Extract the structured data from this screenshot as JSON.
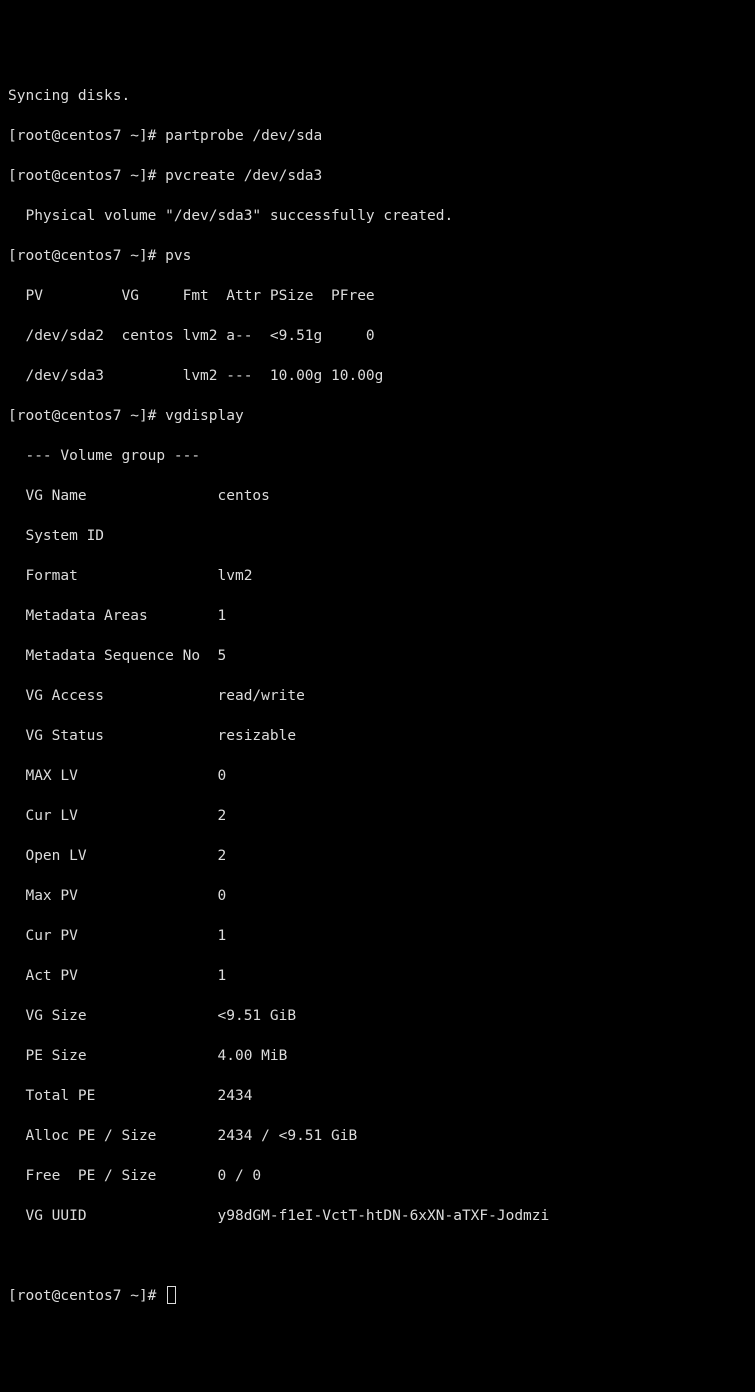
{
  "lines": {
    "syncing": "Syncing disks.",
    "prompt1": "[root@centos7 ~]# partprobe /dev/sda",
    "prompt2": "[root@centos7 ~]# pvcreate /dev/sda3",
    "pvcreate_out": "  Physical volume \"/dev/sda3\" successfully created.",
    "prompt3": "[root@centos7 ~]# pvs",
    "pvs_hdr": "  PV         VG     Fmt  Attr PSize  PFree ",
    "pvs_r1": "  /dev/sda2  centos lvm2 a--  <9.51g     0 ",
    "pvs_r2": "  /dev/sda3         lvm2 ---  10.00g 10.00g",
    "prompt4": "[root@centos7 ~]# vgdisplay",
    "vg_hdr": "  --- Volume group ---",
    "vg_name": "  VG Name               centos",
    "sys_id": "  System ID             ",
    "format": "  Format                lvm2",
    "ma": "  Metadata Areas        1",
    "ms": "  Metadata Sequence No  5",
    "vga": "  VG Access             read/write",
    "vgs": "  VG Status             resizable",
    "maxlv": "  MAX LV                0",
    "curlv": "  Cur LV                2",
    "openlv": "  Open LV               2",
    "maxpv": "  Max PV                0",
    "curpv": "  Cur PV                1",
    "actpv": "  Act PV                1",
    "vgsize": "  VG Size               <9.51 GiB",
    "pesize": "  PE Size               4.00 MiB",
    "totpe": "  Total PE              2434",
    "alloc": "  Alloc PE / Size       2434 / <9.51 GiB",
    "free": "  Free  PE / Size       0 / 0",
    "uuid": "  VG UUID               y98dGM-f1eI-VctT-htDN-6xXN-aTXF-Jodmzi",
    "blank": "   ",
    "prompt5": "[root@centos7 ~]# "
  }
}
